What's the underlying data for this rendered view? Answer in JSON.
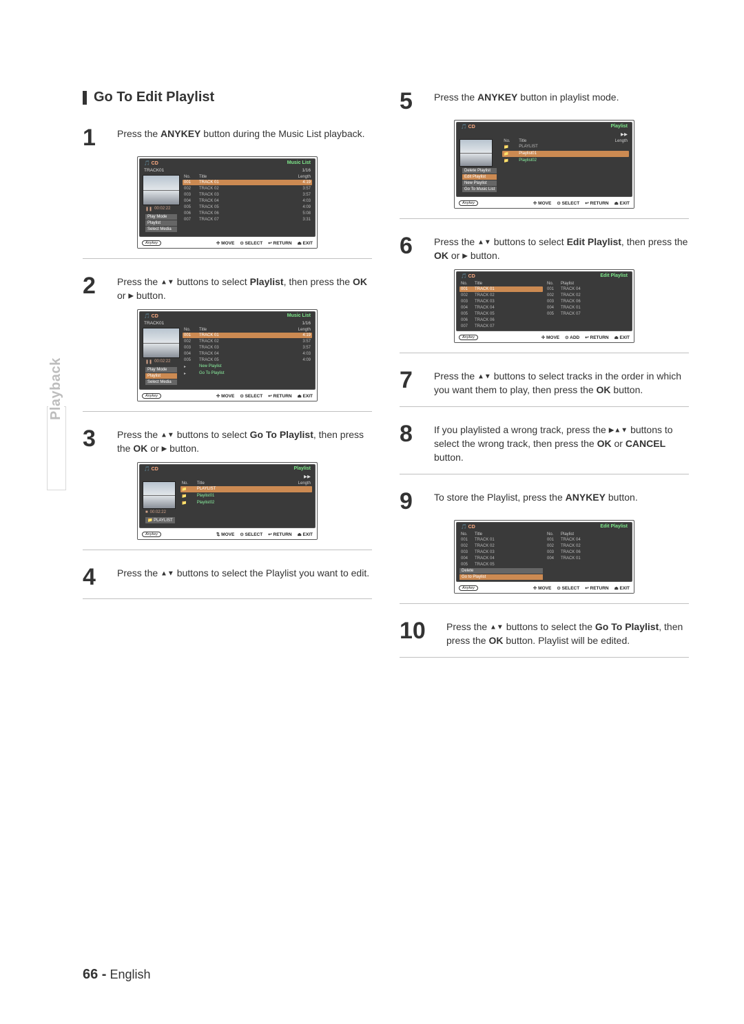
{
  "side_tab": "Playback",
  "heading": "Go To Edit Playlist",
  "page_footer": {
    "num": "66 -",
    "lang": "English"
  },
  "foot": {
    "anykey": "Anykey",
    "move": "MOVE",
    "select": "SELECT",
    "add": "ADD",
    "return": "RETURN",
    "exit": "EXIT"
  },
  "hdr": {
    "no": "No.",
    "title": "Title",
    "length": "Length",
    "playlist": "Playlist"
  },
  "common": {
    "music_list": "Music List",
    "playlist_title": "Playlist",
    "edit_playlist": "Edit Playlist",
    "cd": "CD",
    "track_count": "1/16",
    "track_name": "TRACK01",
    "playlist_item": "PLAYLIST",
    "play_time": "00:02:22"
  },
  "tracks": [
    {
      "no": "001",
      "title": "TRACK 01",
      "len": "4:19"
    },
    {
      "no": "002",
      "title": "TRACK 02",
      "len": "3:57"
    },
    {
      "no": "003",
      "title": "TRACK 03",
      "len": "3:57"
    },
    {
      "no": "004",
      "title": "TRACK 04",
      "len": "4:03"
    },
    {
      "no": "005",
      "title": "TRACK 05",
      "len": "4:09"
    },
    {
      "no": "006",
      "title": "TRACK 06",
      "len": "5:08"
    },
    {
      "no": "007",
      "title": "TRACK 07",
      "len": "3:31"
    }
  ],
  "menu_s1": [
    {
      "label": "Play Mode"
    },
    {
      "label": "Playlist"
    },
    {
      "label": "Select Media"
    }
  ],
  "menu_s2": [
    {
      "label": "Play Mode"
    },
    {
      "label": "Playlist",
      "sub": [
        "New Playlist",
        "Go To Playlist"
      ]
    },
    {
      "label": "Select Media"
    }
  ],
  "menu_s5": [
    {
      "label": "Delete Playlist"
    },
    {
      "label": "Edit Playlist"
    },
    {
      "label": "New Playlist"
    },
    {
      "label": "Go To Music List"
    }
  ],
  "menu_s9": [
    {
      "label": "Delete"
    },
    {
      "label": "Go to Playlist"
    }
  ],
  "playlists": [
    {
      "title": "PLAYLIST"
    },
    {
      "title": "Playlist01"
    },
    {
      "title": "Playlist02"
    }
  ],
  "edit_right": [
    {
      "no": "001",
      "title": "TRACK 04"
    },
    {
      "no": "002",
      "title": "TRACK 02"
    },
    {
      "no": "003",
      "title": "TRACK 06"
    },
    {
      "no": "004",
      "title": "TRACK 01"
    },
    {
      "no": "005",
      "title": "TRACK 07"
    }
  ],
  "edit_right_s9": [
    {
      "no": "001",
      "title": "TRACK 04"
    },
    {
      "no": "002",
      "title": "TRACK 02"
    },
    {
      "no": "003",
      "title": "TRACK 06"
    },
    {
      "no": "004",
      "title": "TRACK 01"
    }
  ],
  "steps": {
    "s1": {
      "n": "1",
      "a": "Press the ",
      "b": "ANYKEY",
      "c": " button during the Music List playback."
    },
    "s2": {
      "n": "2",
      "a": "Press the ",
      "b": " buttons to select ",
      "c": "Playlist",
      "d": ", then press the ",
      "e": "OK",
      "f": " or ",
      "g": " button."
    },
    "s3": {
      "n": "3",
      "a": "Press the ",
      "b": " buttons to select ",
      "c": "Go To Playlist",
      "d": ", then press the ",
      "e": "OK",
      "f": " or ",
      "g": " button."
    },
    "s4": {
      "n": "4",
      "a": "Press the ",
      "b": " buttons to select the Playlist you want to edit."
    },
    "s5": {
      "n": "5",
      "a": "Press the ",
      "b": "ANYKEY",
      "c": " button in playlist mode."
    },
    "s6": {
      "n": "6",
      "a": "Press the ",
      "b": " buttons to select ",
      "c": "Edit Playlist",
      "d": ", then press the ",
      "e": "OK",
      "f": " or ",
      "g": " button."
    },
    "s7": {
      "n": "7",
      "a": "Press the ",
      "b": " buttons to select tracks in the order in which you want them to play, then press the ",
      "c": "OK",
      "d": " button."
    },
    "s8": {
      "n": "8",
      "a": "If you playlisted a wrong track, press the ",
      "b": " buttons to select the wrong track, then press the ",
      "c": "OK",
      "d": " or ",
      "e": "CANCEL",
      "f": " button."
    },
    "s9": {
      "n": "9",
      "a": "To store the Playlist, press the ",
      "b": "ANYKEY",
      "c": " button."
    },
    "s10": {
      "n": "10",
      "a": "Press the ",
      "b": " buttons to select the ",
      "c": "Go To Playlist",
      "d": ", then press the ",
      "e": "OK",
      "f": " button. Playlist will be edited."
    }
  }
}
